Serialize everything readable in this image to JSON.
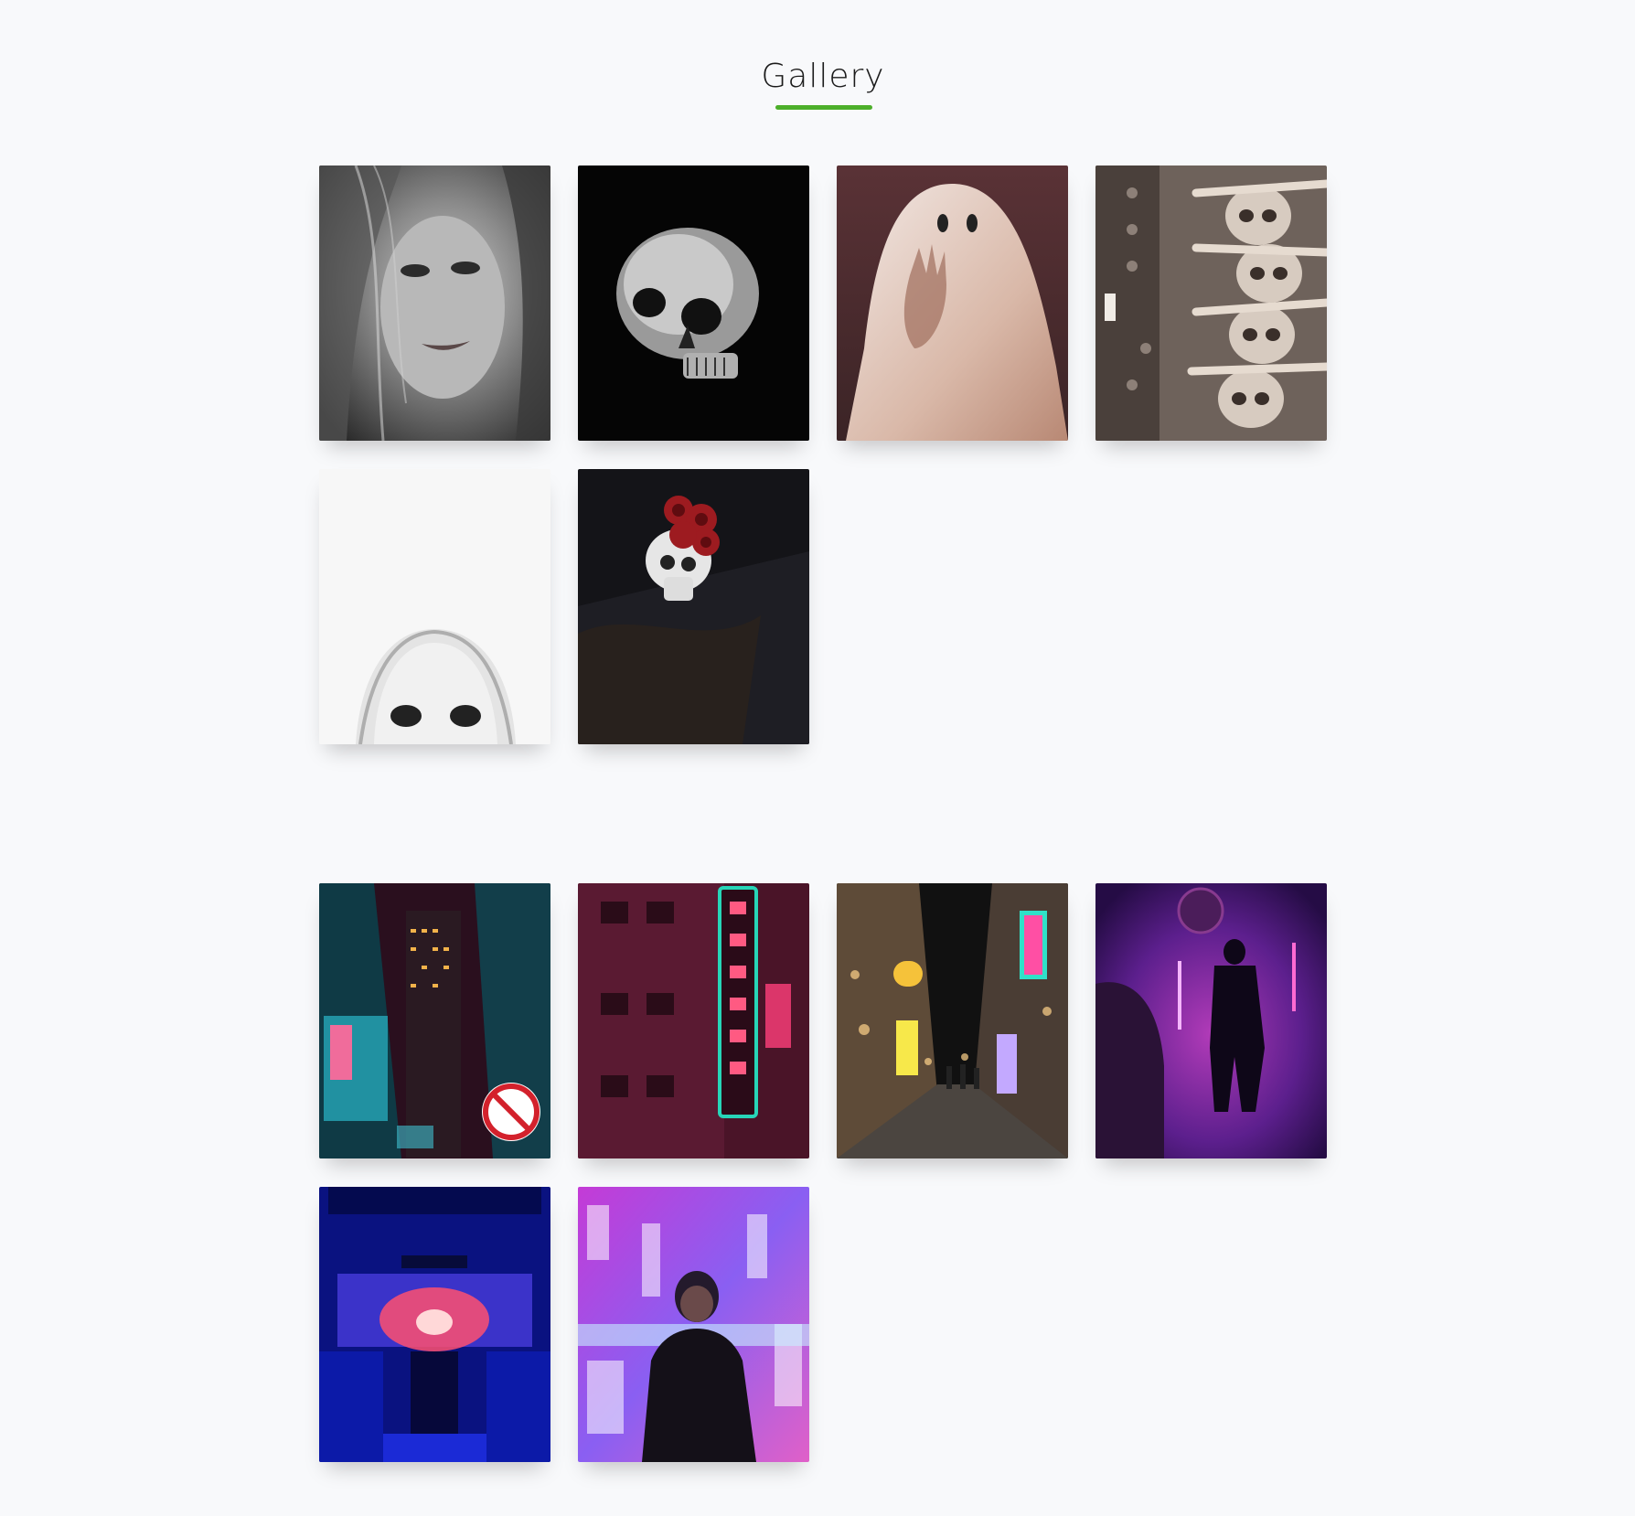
{
  "header": {
    "title": "Gallery",
    "accent_color": "#4caf2a"
  },
  "sections": [
    {
      "images": [
        {
          "subject": "bw-portrait-woman"
        },
        {
          "subject": "skull-on-black"
        },
        {
          "subject": "ghost-sheet"
        },
        {
          "subject": "ossuary-skulls"
        },
        {
          "subject": "pale-face-white"
        },
        {
          "subject": "skull-with-roses"
        }
      ]
    },
    {
      "images": [
        {
          "subject": "neon-city-teal"
        },
        {
          "subject": "neon-sign-building"
        },
        {
          "subject": "night-market-street"
        },
        {
          "subject": "figure-in-purple-fog"
        },
        {
          "subject": "blue-bus-interior"
        },
        {
          "subject": "boy-neon-backdrop"
        }
      ]
    }
  ]
}
